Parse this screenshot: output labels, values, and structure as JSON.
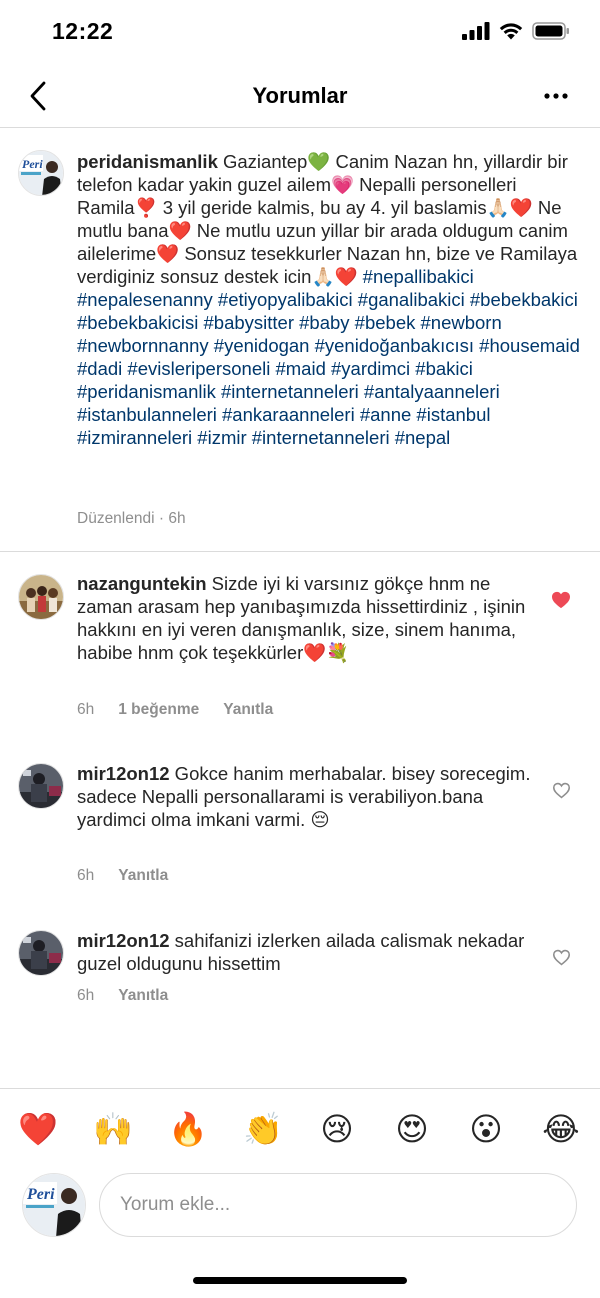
{
  "status_bar": {
    "time": "12:22"
  },
  "header": {
    "title": "Yorumlar"
  },
  "caption": {
    "username": "peridanismanlik",
    "text_1": " Gaziantep💚 Canim Nazan hn, yillardir bir telefon kadar yakin guzel ailem💗 Nepalli personelleri Ramila❣️ 3 yil geride kalmis, bu ay 4. yil baslamis🙏🏻❤️ Ne mutlu bana❤️ Ne mutlu uzun yillar bir arada oldugum canim ailelerime❤️ Sonsuz tesekkurler Nazan hn, bize ve Ramilaya verdiginiz sonsuz destek icin🙏🏻❤️ ",
    "hashtags": "#nepallibakici #nepalesenanny #etiyopyalibakici #ganalibakici #bebekbakici #bebekbakicisi #babysitter #baby #bebek #newborn #newbornnanny #yenidogan #yenidoğanbakıcısı #housemaid #dadi #evisleripersoneli #maid #yardimci #bakici #peridanismanlik #internetanneleri #antalyaanneleri #istanbulanneleri #ankaraanneleri #anne #istanbul #izmiranneleri #izmir #internetanneleri #nepal",
    "edited": "Düzenlendi · 6h"
  },
  "comments": [
    {
      "username": "nazanguntekin",
      "text": " Sizde iyi ki varsınız gökçe hnm ne zaman arasam hep yanıbaşımızda hissettirdiniz , işinin  hakkını en iyi veren danışmanlık, size, sinem hanıma, habibe hnm çok teşekkürler❤️💐",
      "time": "6h",
      "likes": "1 beğenme",
      "reply": "Yanıtla",
      "liked": true
    },
    {
      "username": "mir12on12",
      "text": " Gokce hanim merhabalar.  bisey sorecegim. sadece Nepalli personallarami is verabiliyon.bana yardimci olma imkani varmi. 😔",
      "time": "6h",
      "reply": "Yanıtla",
      "liked": false
    },
    {
      "username": "mir12on12",
      "text": " sahifanizi izlerken ailada calismak nekadar guzel oldugunu hissettim",
      "time": "6h",
      "reply": "Yanıtla",
      "liked": false
    }
  ],
  "emoji_bar": [
    "❤️",
    "🙌",
    "🔥",
    "👏",
    "😢",
    "😍",
    "😮",
    "😂"
  ],
  "composer": {
    "placeholder": "Yorum ekle...",
    "avatar_text": "Peri"
  },
  "colors": {
    "link": "#00376b",
    "like_red": "#ed4956",
    "muted": "#8e8e8e",
    "divider": "#dbdbdb"
  }
}
